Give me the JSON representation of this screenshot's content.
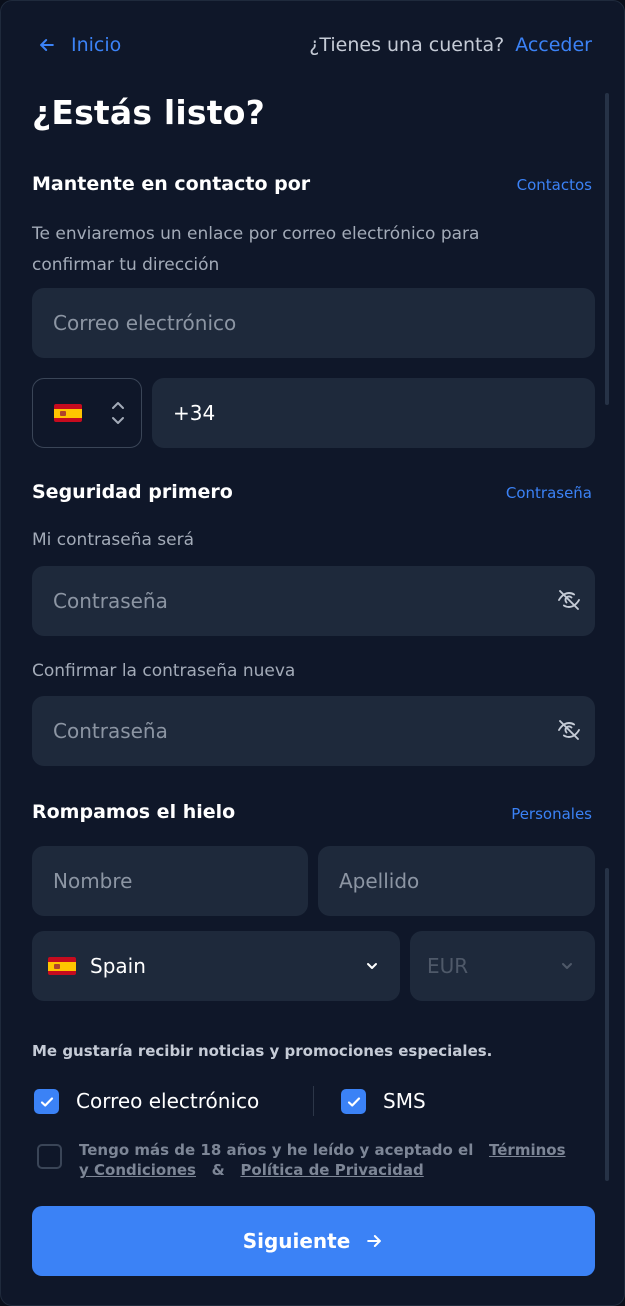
{
  "header": {
    "back_label": "Inicio",
    "account_question": "¿Tienes una cuenta?",
    "login_label": "Acceder"
  },
  "title": "¿Estás listo?",
  "contact": {
    "section_title": "Mantente en contacto por",
    "section_link": "Contactos",
    "description": "Te enviaremos un enlace por correo electrónico para confirmar tu dirección",
    "email_placeholder": "Correo electrónico",
    "phone_prefix_value": "+34"
  },
  "security": {
    "section_title": "Seguridad primero",
    "section_link": "Contraseña",
    "password_label": "Mi contraseña será",
    "password_placeholder": "Contraseña",
    "confirm_label": "Confirmar la contraseña nueva",
    "confirm_placeholder": "Contraseña"
  },
  "personal": {
    "section_title": "Rompamos el hielo",
    "section_link": "Personales",
    "first_name_placeholder": "Nombre",
    "last_name_placeholder": "Apellido",
    "country_value": "Spain",
    "currency_value": "EUR"
  },
  "promotions": {
    "label": "Me gustaría recibir noticias y promociones especiales.",
    "email_option": "Correo electrónico",
    "sms_option": "SMS",
    "email_checked": true,
    "sms_checked": true
  },
  "terms": {
    "prefix": "Tengo más de 18 años y he leído y aceptado el",
    "terms_link": "Términos y Condiciones",
    "ampersand": "&",
    "privacy_link": "Política de Privacidad",
    "checked": false
  },
  "submit_label": "Siguiente",
  "colors": {
    "accent": "#3b82f6",
    "background": "#0f1729",
    "field": "#1e293b"
  }
}
